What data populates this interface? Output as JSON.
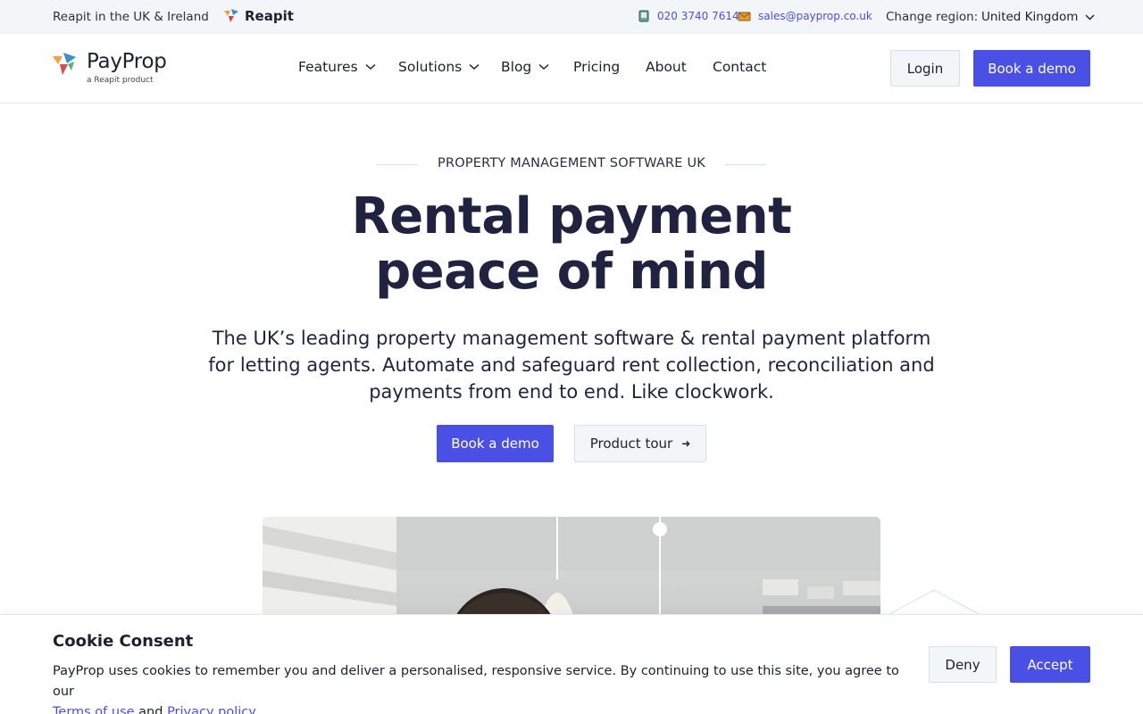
{
  "topbar": {
    "reapit_text": "Reapit in the UK & Ireland",
    "reapit_logo": "Reapit",
    "phone": "020 3740 7614",
    "email": "sales@payprop.co.uk",
    "region_label": "Change region:",
    "region_value": "United Kingdom"
  },
  "brand": {
    "name": "PayProp",
    "sub": "a Reapit product"
  },
  "nav": {
    "features": "Features",
    "solutions": "Solutions",
    "blog": "Blog",
    "pricing": "Pricing",
    "about": "About",
    "contact": "Contact"
  },
  "header_actions": {
    "login": "Login",
    "book_demo": "Book a demo"
  },
  "hero": {
    "eyebrow": "PROPERTY MANAGEMENT SOFTWARE UK",
    "title_line1": "Rental payment",
    "title_line2": "peace of mind",
    "subtitle": "The UK’s leading property management software & rental payment platform for letting agents. Automate and safeguard rent collection, reconciliation and payments from end to end. Like clockwork.",
    "cta_primary": "Book a demo",
    "cta_secondary": "Product tour",
    "cta_secondary_arrow": "➜"
  },
  "cookie": {
    "title": "Cookie Consent",
    "text": "PayProp uses cookies to remember you and deliver a personalised, responsive service. By continuing to use this site, you agree to our",
    "terms_link": "Terms of use",
    "and": "and",
    "privacy_link": "Privacy policy",
    "period": ".",
    "deny": "Deny",
    "accept": "Accept"
  },
  "colors": {
    "accent": "#4a4fe6",
    "text": "#1f2340",
    "topbar_bg": "#f3f6f8"
  },
  "icons": {
    "phone": "phone-icon",
    "email": "email-icon",
    "chevron": "chevron-down-icon",
    "arrow": "arrow-right-icon"
  }
}
